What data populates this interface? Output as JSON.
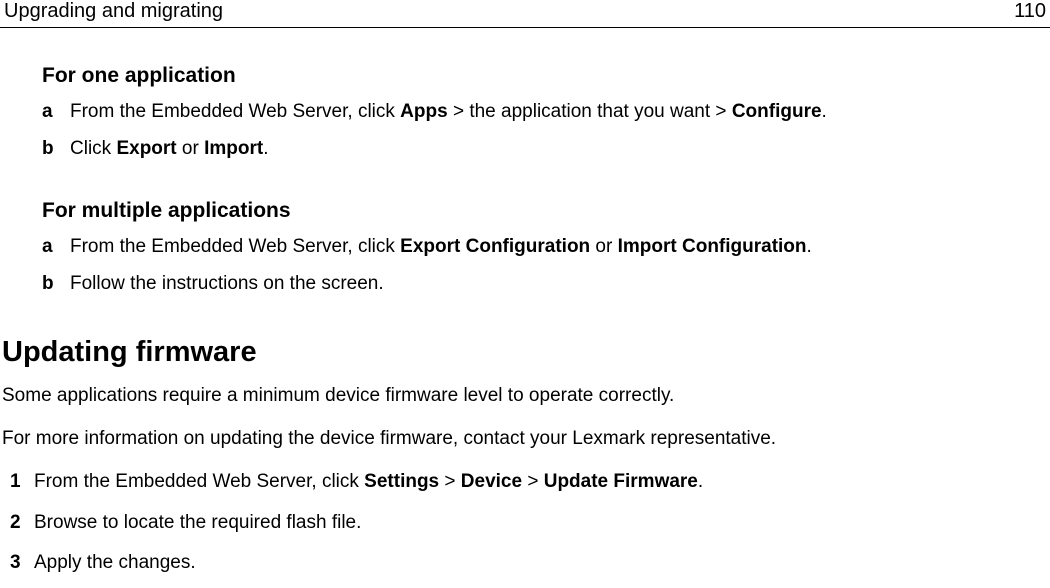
{
  "header": {
    "title": "Upgrading and migrating",
    "page_number": "110"
  },
  "section1": {
    "heading": "For one application",
    "items": [
      {
        "marker": "a",
        "prefix": "From the Embedded Web Server, click ",
        "bold1": "Apps",
        "mid1": " > the application that you want > ",
        "bold2": "Configure",
        "suffix": "."
      },
      {
        "marker": "b",
        "prefix": "Click ",
        "bold1": "Export",
        "mid1": " or ",
        "bold2": "Import",
        "suffix": "."
      }
    ]
  },
  "section2": {
    "heading": "For multiple applications",
    "items": [
      {
        "marker": "a",
        "prefix": "From the Embedded Web Server, click ",
        "bold1": "Export Configuration",
        "mid1": " or ",
        "bold2": "Import Configuration",
        "suffix": "."
      },
      {
        "marker": "b",
        "text": "Follow the instructions on the screen."
      }
    ]
  },
  "section3": {
    "heading": "Updating firmware",
    "para1": "Some applications require a minimum device firmware level to operate correctly.",
    "para2": "For more information on updating the device firmware, contact your Lexmark representative.",
    "items": [
      {
        "marker": "1",
        "prefix": "From the Embedded Web Server, click ",
        "bold1": "Settings",
        "mid1": " > ",
        "bold2": "Device",
        "mid2": " > ",
        "bold3": "Update Firmware",
        "suffix": "."
      },
      {
        "marker": "2",
        "text": "Browse to locate the required flash file."
      },
      {
        "marker": "3",
        "text": "Apply the changes."
      }
    ]
  }
}
